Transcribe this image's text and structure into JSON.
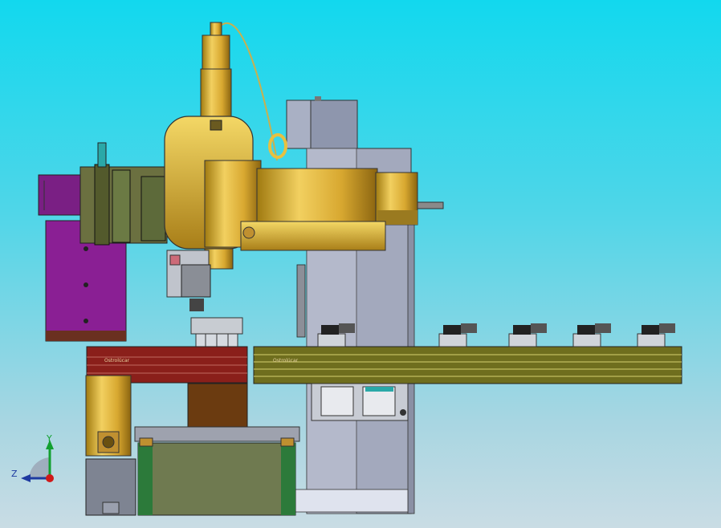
{
  "viewport": {
    "background_top": "#12d8ee",
    "background_bottom": "#c9dce4"
  },
  "rail_label_left": "Ostrolúcar",
  "rail_label_right": "Ostrolúcar",
  "axis_triad": {
    "z_label": "Z",
    "y_label": "Y",
    "z_color": "#1e3aa0",
    "y_color": "#12a030",
    "origin_color": "#d01818"
  },
  "colors": {
    "spindle_gold": "#d8b040",
    "frame_gray": "#9ea6b8",
    "purple_plate": "#8a1f94",
    "rail_olive": "#6f6e1e",
    "red_block": "#8a1f1a",
    "brown_block": "#6b3b10",
    "base_box": "#6f7a50"
  }
}
